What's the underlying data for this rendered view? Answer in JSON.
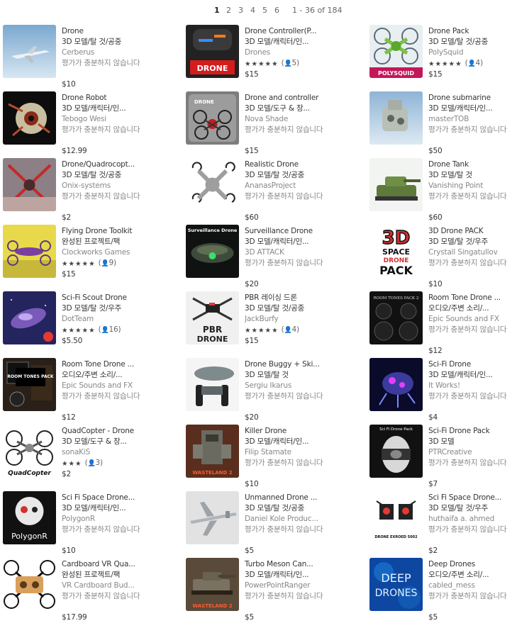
{
  "pagination": {
    "pages": [
      "1",
      "2",
      "3",
      "4",
      "5",
      "6"
    ],
    "current": "1",
    "range": "1 - 36 of 184"
  },
  "items": [
    {
      "title": "Drone",
      "category": "3D 모델/탈 것/공중",
      "publisher": "Cerberus",
      "note": "평가가 충분하지 않습니다",
      "price": "$10",
      "thumb": "jet"
    },
    {
      "title": "Drone Controller(P...",
      "category": "3D 모델/캐릭터/인...",
      "publisher": "Drones",
      "stars": "★★★★★",
      "count": "5",
      "price": "$15",
      "thumb": "controller",
      "thumb_label": "DRONE"
    },
    {
      "title": "Drone Pack",
      "category": "3D 모델/탈 것/공중",
      "publisher": "PolySquid",
      "stars": "★★★★★",
      "count": "4",
      "price": "$15",
      "thumb": "polysquid",
      "thumb_label": "POLYSQUID"
    },
    {
      "title": "Drone Robot",
      "category": "3D 모델/캐릭터/인...",
      "publisher": "Tebogo Wesi",
      "note": "평가가 충분하지 않습니다",
      "price": "$12.99",
      "thumb": "robot"
    },
    {
      "title": "Drone and controller",
      "category": "3D 모델/도구 & 장...",
      "publisher": "Nova Shade",
      "note": "평가가 충분하지 않습니다",
      "price": "$15",
      "thumb": "droneController",
      "thumb_label": "DRONE"
    },
    {
      "title": "Drone submarine",
      "category": "3D 모델/캐릭터/인...",
      "publisher": "masterTOB",
      "note": "평가가 충분하지 않습니다",
      "price": "$50",
      "thumb": "submarine"
    },
    {
      "title": "Drone/Quadrocopt...",
      "category": "3D 모델/탈 것/공중",
      "publisher": "Onix-systems",
      "note": "평가가 충분하지 않습니다",
      "price": "$2",
      "thumb": "quadX"
    },
    {
      "title": "Realistic Drone",
      "category": "3D 모델/탈 것/공중",
      "publisher": "AnanasProject",
      "note": "평가가 충분하지 않습니다",
      "price": "$60",
      "thumb": "realistic"
    },
    {
      "title": "Drone Tank",
      "category": "3D 모델/탈 것",
      "publisher": "Vanishing Point",
      "note": "평가가 충분하지 않습니다",
      "price": "$60",
      "thumb": "tank"
    },
    {
      "title": "Flying Drone Toolkit",
      "category": "완성된 프로젝트/팩",
      "publisher": "Clockworks Games",
      "stars": "★★★★★",
      "count": "9",
      "price": "$15",
      "thumb": "toolkit"
    },
    {
      "title": "Surveillance Drone",
      "category": "3D 모델/캐릭터/인...",
      "publisher": "3D ATTACK",
      "note": "평가가 충분하지 않습니다",
      "price": "$20",
      "thumb": "surveillance",
      "thumb_label": "Surveillance Drone"
    },
    {
      "title": "3D Drone PACK",
      "category": "3D 모델/탈 것/우주",
      "publisher": "Crystall Singatullov",
      "note": "평가가 충분하지 않습니다",
      "price": "$10",
      "thumb": "space3d",
      "thumb_label": "3D",
      "thumb_label2": "SPACE",
      "thumb_label3": "DRONE",
      "thumb_label4": "PACK"
    },
    {
      "title": "Sci-Fi Scout Drone",
      "category": "3D 모델/탈 것/우주",
      "publisher": "DotTeam",
      "stars": "★★★★★",
      "count": "16",
      "price": "$5.50",
      "thumb": "scout"
    },
    {
      "title": "PBR 레이싱 드론",
      "category": "3D 모델/탈 것/공중",
      "publisher": "JackBurfy",
      "stars": "★★★★★",
      "count": "4",
      "price": "$15",
      "thumb": "pbr",
      "thumb_label": "PBR",
      "thumb_label2": "DRONE"
    },
    {
      "title": "Room Tone Drone ...",
      "category": "오디오/주변 소리/...",
      "publisher": "Epic Sounds and FX",
      "note": "평가가 충분하지 않습니다",
      "price": "$12",
      "thumb": "speakers",
      "thumb_label": "ROOM TONES PACK 2"
    },
    {
      "title": "Room Tone Drone ...",
      "category": "오디오/주변 소리/...",
      "publisher": "Epic Sounds and FX",
      "note": "평가가 충분하지 않습니다",
      "price": "$12",
      "thumb": "roomtones",
      "thumb_label": "ROOM TONES PACK"
    },
    {
      "title": "Drone Buggy + Ski...",
      "category": "3D 모델/탈 것",
      "publisher": "Sergiu Ikarus",
      "note": "평가가 충분하지 않습니다",
      "price": "$20",
      "thumb": "buggy"
    },
    {
      "title": "Sci-Fi Drone",
      "category": "3D 모델/캐릭터/인...",
      "publisher": "It Works!",
      "note": "평가가 충분하지 않습니다",
      "price": "$4",
      "thumb": "scifiGlow"
    },
    {
      "title": "QuadCopter - Drone",
      "category": "3D 모델/도구 & 장...",
      "publisher": "sonaKiS",
      "stars": "★★★",
      "count": "3",
      "price": "$2",
      "thumb": "quadcopter",
      "thumb_label": "QuadCopter"
    },
    {
      "title": "Killer Drone",
      "category": "3D 모델/캐릭터/인...",
      "publisher": "Filip Stamate",
      "note": "평가가 충분하지 않습니다",
      "price": "$10",
      "thumb": "killer",
      "thumb_label": "WASTELAND 2"
    },
    {
      "title": "Sci-Fi Drone Pack",
      "category": "3D 모델",
      "publisher": "PTRCreative",
      "note": "평가가 충분하지 않습니다",
      "price": "$7",
      "thumb": "capsule",
      "thumb_label": "Sci Fi Drone Pack"
    },
    {
      "title": "Sci Fi Space Drone...",
      "category": "3D 모델/캐릭터/인...",
      "publisher": "PolygonR",
      "note": "평가가 충분하지 않습니다",
      "price": "$10",
      "thumb": "polygonr",
      "thumb_label": "PolygonR"
    },
    {
      "title": "Unmanned Drone ...",
      "category": "3D 모델/탈 것/공중",
      "publisher": "Daniel Kole Produc...",
      "note": "평가가 충분하지 않습니다",
      "price": "$5",
      "thumb": "unmanned"
    },
    {
      "title": "Sci Fi Space Drone...",
      "category": "3D 모델/탈 것/우주",
      "publisher": "huthaifa a. ahmed",
      "note": "평가가 충분하지 않습니다",
      "price": "$2",
      "thumb": "exroed",
      "thumb_label": "DRONE EXROED 5002"
    },
    {
      "title": "Cardboard VR Qua...",
      "category": "완성된 프로젝트/팩",
      "publisher": "VR Cardboard Bud...",
      "note": "평가가 충분하지 않습니다",
      "price": "$17.99",
      "thumb": "cardboard"
    },
    {
      "title": "Turbo Meson Can...",
      "category": "3D 모델/캐릭터/인...",
      "publisher": "PowerPointRanger",
      "note": "평가가 충분하지 않습니다",
      "price": "$5",
      "thumb": "turbo",
      "thumb_label": "WASTELAND 2"
    },
    {
      "title": "Deep Drones",
      "category": "오디오/주변 소리/...",
      "publisher": "cabled_mess",
      "note": "평가가 충분하지 않습니다",
      "price": "$5",
      "thumb": "deep",
      "thumb_label": "DEEP",
      "thumb_label2": "DRONES"
    }
  ]
}
